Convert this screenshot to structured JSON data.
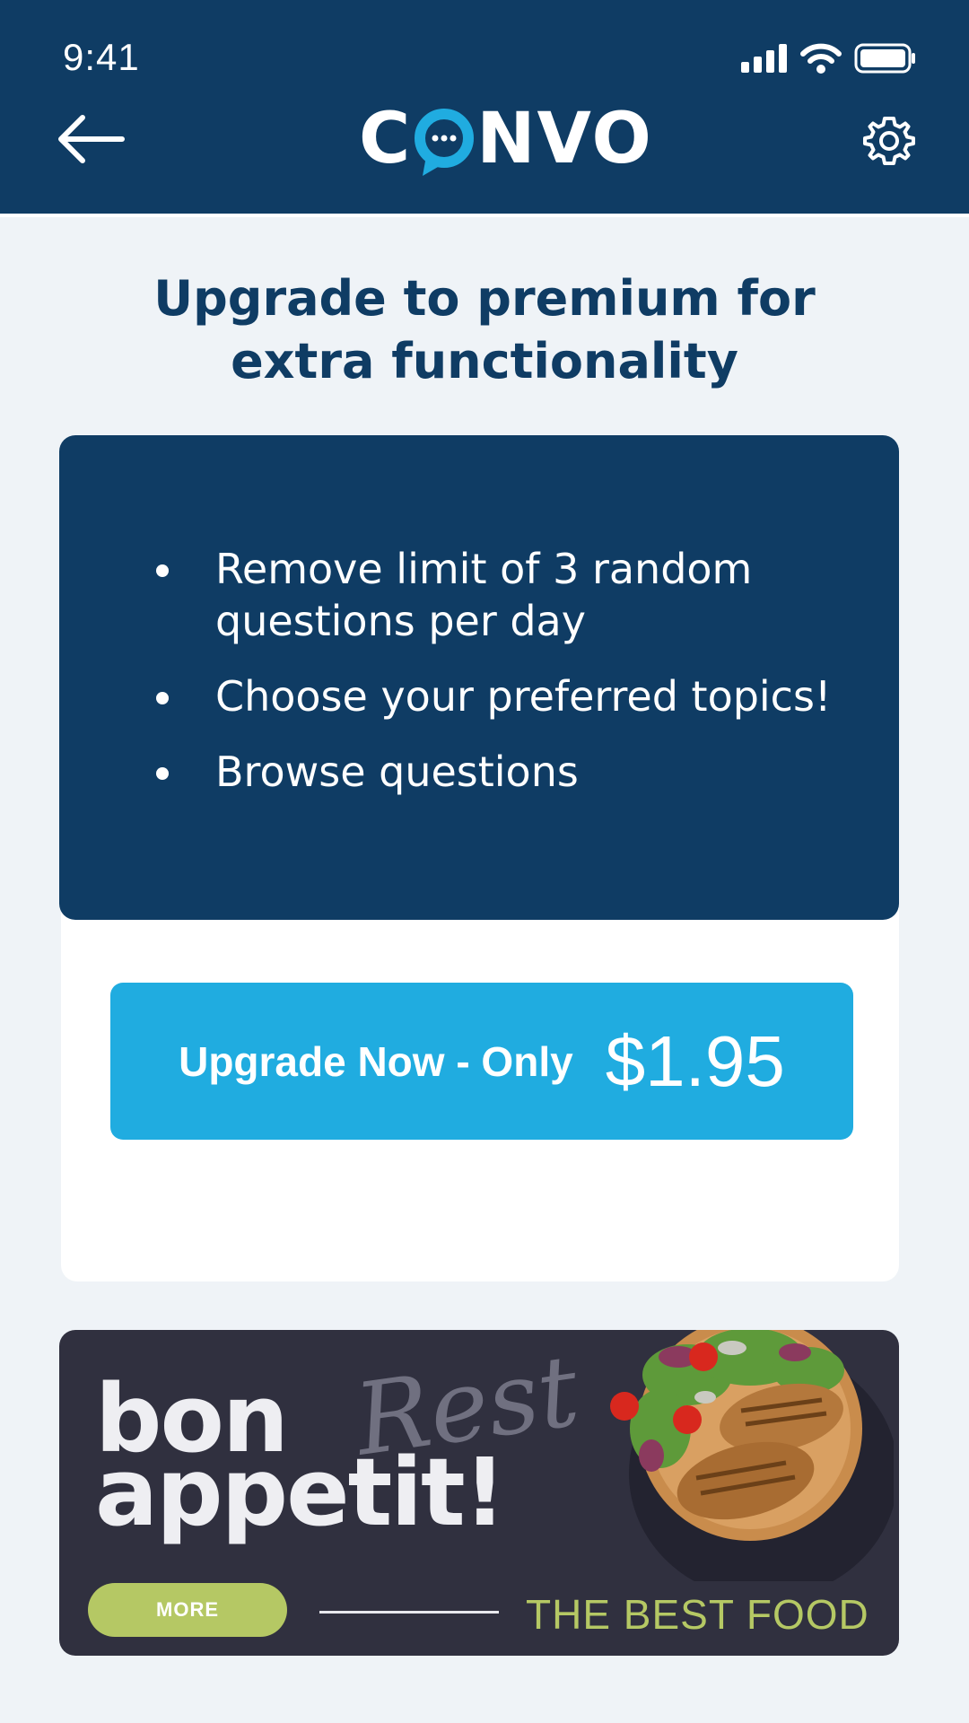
{
  "status_bar": {
    "time": "9:41"
  },
  "header": {
    "logo_left": "C",
    "logo_right": "NVO",
    "back_icon": "arrow-left-icon",
    "settings_icon": "gear-icon"
  },
  "headline": "Upgrade to premium for extra functionality",
  "features": [
    "Remove limit of 3 random questions per day",
    "Choose your preferred topics!",
    "Browse questions"
  ],
  "upgrade_button": {
    "label": "Upgrade Now - Only",
    "price": "$1.95"
  },
  "ad": {
    "title_line1": "bon",
    "title_line2": "appetit!",
    "script_text": "Rest",
    "more_label": "MORE",
    "tagline": "THE BEST FOOD"
  },
  "colors": {
    "header_bg": "#0f3c64",
    "accent_blue": "#20ace0",
    "ad_bg": "#30303f",
    "ad_green": "#b5c864"
  }
}
